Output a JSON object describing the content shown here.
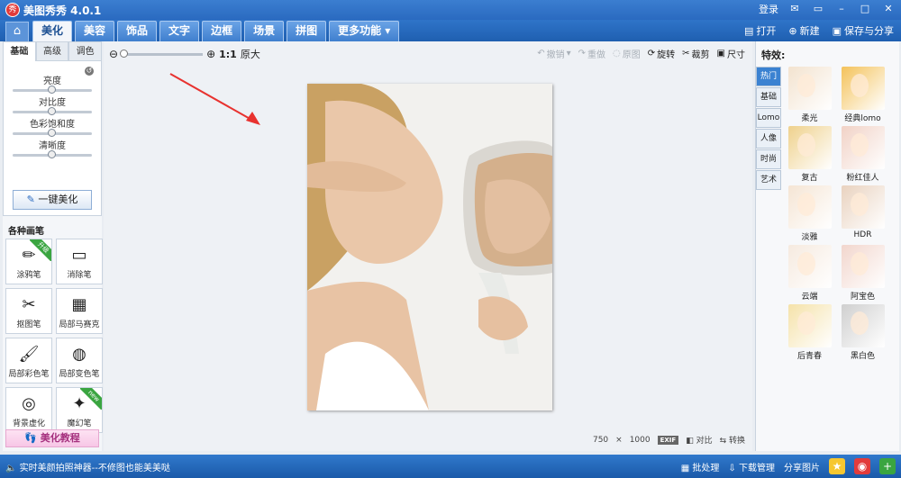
{
  "app": {
    "title": "美图秀秀 4.0.1",
    "login": "登录"
  },
  "window_icons": {
    "msg": "✉",
    "skin": "▭",
    "min": "–",
    "max": "□",
    "close": "✕"
  },
  "tabs": [
    {
      "label": "美化",
      "active": true
    },
    {
      "label": "美容"
    },
    {
      "label": "饰品"
    },
    {
      "label": "文字"
    },
    {
      "label": "边框"
    },
    {
      "label": "场景"
    },
    {
      "label": "拼图"
    },
    {
      "label": "更多功能 ▾"
    }
  ],
  "menu_right": {
    "open": "打开",
    "new": "新建",
    "save": "保存与分享"
  },
  "left": {
    "subtabs": [
      "基础",
      "高级",
      "调色"
    ],
    "sliders": [
      {
        "label": "亮度",
        "level": 0.5
      },
      {
        "label": "对比度",
        "level": 0.5
      },
      {
        "label": "色彩饱和度",
        "level": 0.5
      },
      {
        "label": "清晰度",
        "level": 0.5
      }
    ],
    "onekey": "一键美化",
    "brush_title": "各种画笔",
    "brushes": [
      {
        "label": "涂鸦笔",
        "icon": "✏",
        "badge": "升级"
      },
      {
        "label": "消除笔",
        "icon": "▭",
        "badge": ""
      },
      {
        "label": "抠图笔",
        "icon": "✂",
        "badge": ""
      },
      {
        "label": "局部马赛克",
        "icon": "▦",
        "badge": ""
      },
      {
        "label": "局部彩色笔",
        "icon": "🖌",
        "badge": ""
      },
      {
        "label": "局部变色笔",
        "icon": "◍",
        "badge": ""
      },
      {
        "label": "背景虚化",
        "icon": "◎",
        "badge": ""
      },
      {
        "label": "魔幻笔",
        "icon": "✦",
        "badge": "new"
      }
    ],
    "tutorial": "美化教程"
  },
  "canvas": {
    "ratio": "1:1",
    "original": "原大",
    "ops": {
      "undo": "撤销",
      "redo": "重做",
      "orig": "原图",
      "rotate": "旋转",
      "crop": "裁剪",
      "size": "尺寸"
    },
    "dims_w": "750",
    "dims_x": "×",
    "dims_h": "1000",
    "exif": "EXIF",
    "compare": "对比",
    "convert": "转换"
  },
  "effects": {
    "title": "特效:",
    "categories": [
      "热门",
      "基础",
      "Lomo",
      "人像",
      "时尚",
      "艺术"
    ],
    "items": [
      {
        "label": "柔光",
        "color": "#f3e3cf"
      },
      {
        "label": "经典lomo",
        "color": "#f4c25a"
      },
      {
        "label": "复古",
        "color": "#efd18c"
      },
      {
        "label": "粉红佳人",
        "color": "#f1d2c6"
      },
      {
        "label": "淡雅",
        "color": "#f5e5d4"
      },
      {
        "label": "HDR",
        "color": "#e9d2bf"
      },
      {
        "label": "云端",
        "color": "#f6eadf"
      },
      {
        "label": "阿宝色",
        "color": "#f2d6cd"
      },
      {
        "label": "后青春",
        "color": "#f5e2a9"
      },
      {
        "label": "黑白色",
        "color": "#cfcfcf"
      }
    ]
  },
  "bottom": {
    "hint": "实时美颜拍照神器--不修图也能美美哒",
    "batch": "批处理",
    "download": "下载管理",
    "share": "分享图片"
  }
}
